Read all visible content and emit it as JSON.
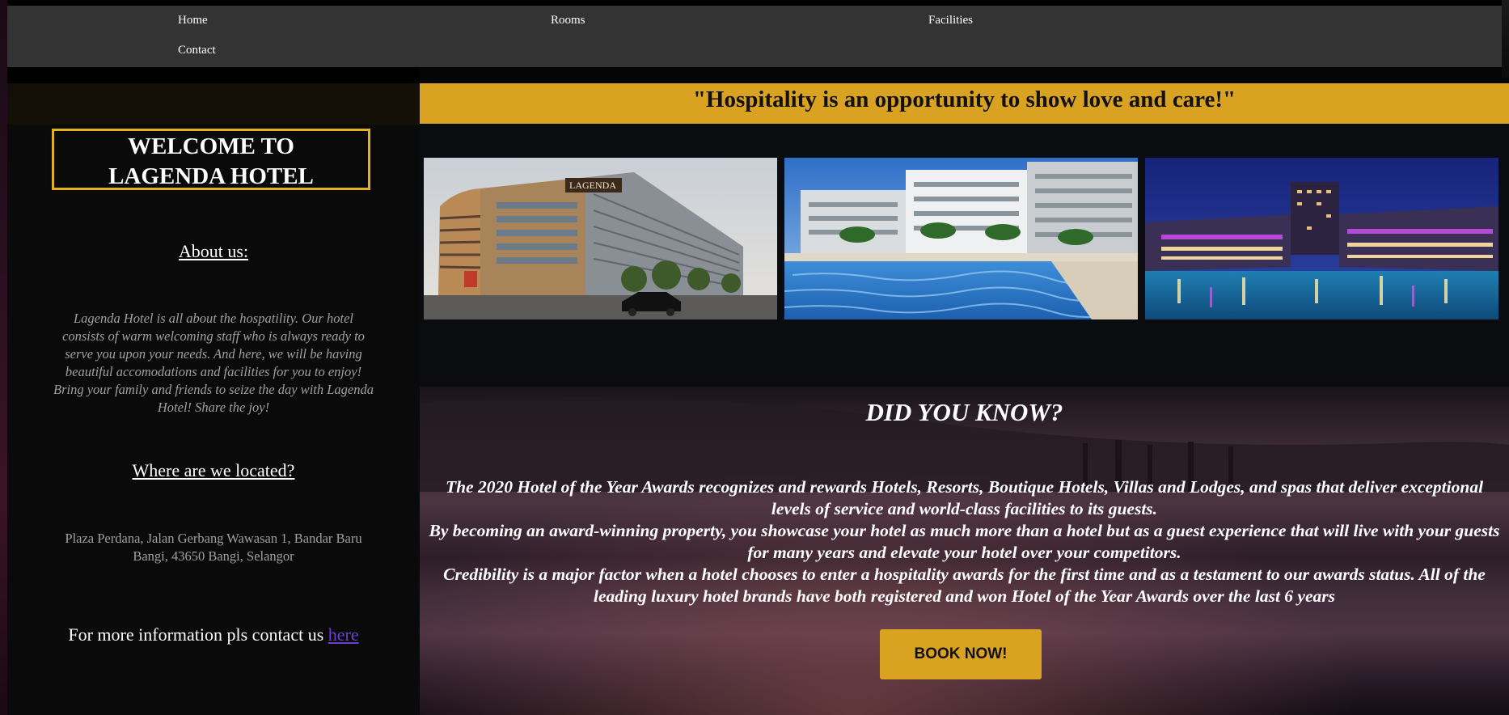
{
  "nav": {
    "items": [
      {
        "label": "Home"
      },
      {
        "label": "Rooms"
      },
      {
        "label": "Facilities"
      },
      {
        "label": "Contact"
      }
    ]
  },
  "sidebar": {
    "welcome_line1": "WELCOME TO",
    "welcome_line2": "LAGENDA HOTEL",
    "about_heading": "About us:",
    "about_text": "Lagenda Hotel is all about the hospatility. Our hotel consists of warm welcoming staff who is always ready to serve you upon your needs. And here, we will be having beautiful accomodations and facilities for you to enjoy! Bring your family and friends to seize the day with Lagenda Hotel! Share the joy!",
    "location_heading": "Where are we located?",
    "address": "Plaza Perdana, Jalan Gerbang Wawasan 1, Bandar Baru Bangi, 43650 Bangi, Selangor",
    "contact_prefix": "For more information pls contact us ",
    "contact_link": "here"
  },
  "main": {
    "quote": "\"Hospitality is an opportunity to show love and care!\"",
    "photos": [
      {
        "logo_text": "LAGENDA"
      },
      {},
      {}
    ],
    "did_you_know_title": "DID YOU KNOW?",
    "did_you_know_paragraphs": [
      "The 2020 Hotel of the Year Awards recognizes and rewards Hotels, Resorts, Boutique Hotels, Villas and Lodges, and spas that deliver exceptional levels of service and world-class facilities to its guests.",
      "By becoming an award-winning property, you showcase your hotel as much more than a hotel but as a guest experience that will live with your guests for many years and elevate your hotel over your competitors.",
      "Credibility is a major factor when a hotel chooses to enter a hospitality awards for the first time and as a testament to our awards status. All of the leading luxury hotel brands have both registered and won Hotel of the Year Awards over the last 6 years"
    ],
    "book_button": "BOOK NOW!"
  },
  "colors": {
    "accent_gold": "#d9a220",
    "nav_bg": "#333333",
    "link_purple": "#6a3fd0"
  }
}
